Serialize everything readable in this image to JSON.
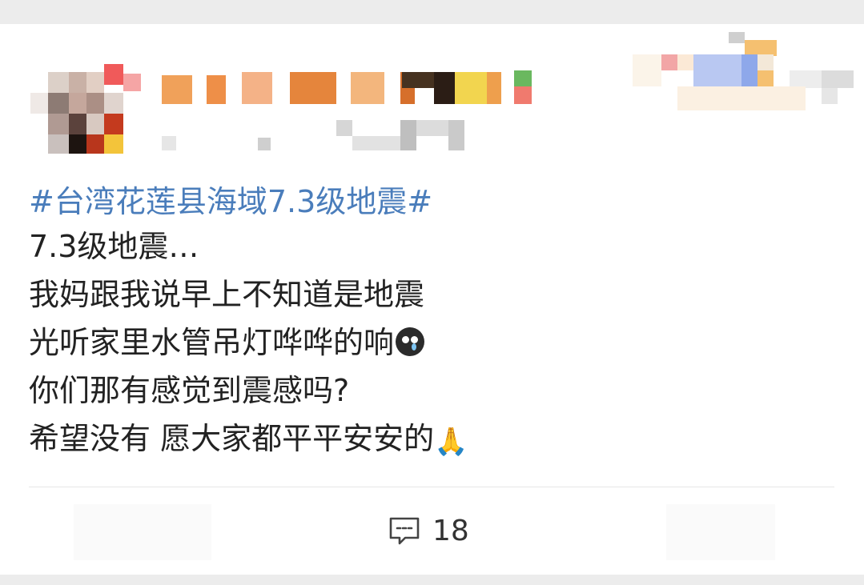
{
  "post": {
    "hashtag": "#台湾花莲县海域7.3级地震#",
    "lines": [
      "7.3级地震…",
      "我妈跟我说早上不知道是地震",
      "光听家里水管吊灯哗哗的响",
      "你们那有感觉到震感吗?",
      "希望没有 愿大家都平平安安的"
    ]
  },
  "actions": {
    "comment_count": "18"
  },
  "icons": {
    "line3_emoji": "crying-face-icon",
    "line5_emoji": "folded-hands-icon",
    "comment": "comment-icon"
  },
  "colors": {
    "hashtag": "#4a7dbb",
    "text": "#222222",
    "background": "#ececec",
    "card": "#ffffff"
  }
}
